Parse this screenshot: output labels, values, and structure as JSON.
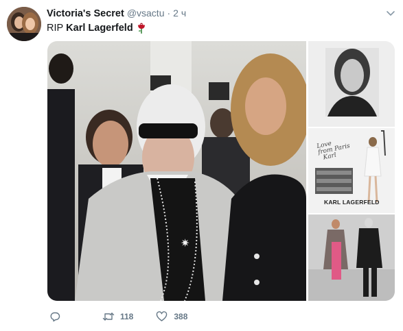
{
  "author": {
    "display_name": "Victoria's Secret",
    "handle": "@vsactu",
    "separator": "·",
    "time": "2 ч",
    "avatar_icon": "profile-avatar"
  },
  "text": {
    "prefix": "RIP",
    "name": "Karl Lagerfeld",
    "emoji_icon": "rose-icon"
  },
  "media": {
    "thumb2_signature": "Love\nfrom Paris\nKarl",
    "thumb2_brand": "KARL LAGERFELD"
  },
  "actions": {
    "reply_icon": "reply-icon",
    "retweet_icon": "retweet-icon",
    "retweet_count": "118",
    "like_icon": "heart-icon",
    "like_count": "388"
  },
  "colors": {
    "secondary_text": "#657786",
    "primary_text": "#14171a",
    "rose": "#c0162a"
  }
}
